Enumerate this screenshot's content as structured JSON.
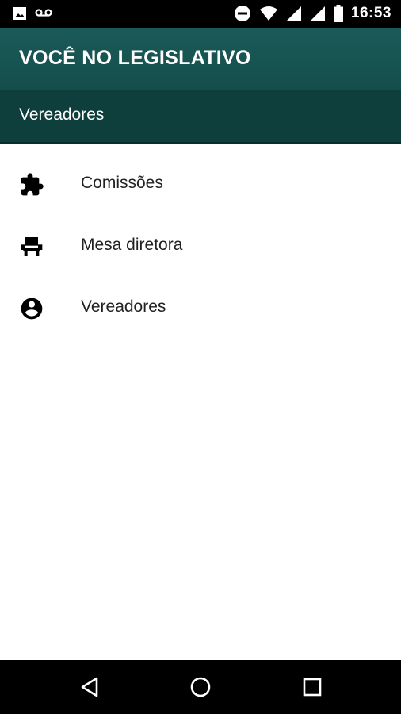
{
  "status_bar": {
    "time": "16:53",
    "icons": [
      "image-icon",
      "voicemail-icon",
      "do-not-disturb-icon",
      "wifi-icon",
      "signal-icon",
      "signal-icon",
      "battery-icon"
    ]
  },
  "app_bar": {
    "title": "VOCÊ NO LEGISLATIVO"
  },
  "sub_bar": {
    "title": "Vereadores"
  },
  "menu": {
    "items": [
      {
        "label": "Comissões",
        "icon": "puzzle-icon"
      },
      {
        "label": "Mesa diretora",
        "icon": "chair-icon"
      },
      {
        "label": "Vereadores",
        "icon": "account-circle-icon"
      }
    ]
  },
  "nav_bar": {
    "buttons": [
      "back-icon",
      "home-icon",
      "recents-icon"
    ]
  },
  "colors": {
    "app_bar": "#1a5a58",
    "sub_bar": "#0f3f3d",
    "text": "#212121"
  }
}
